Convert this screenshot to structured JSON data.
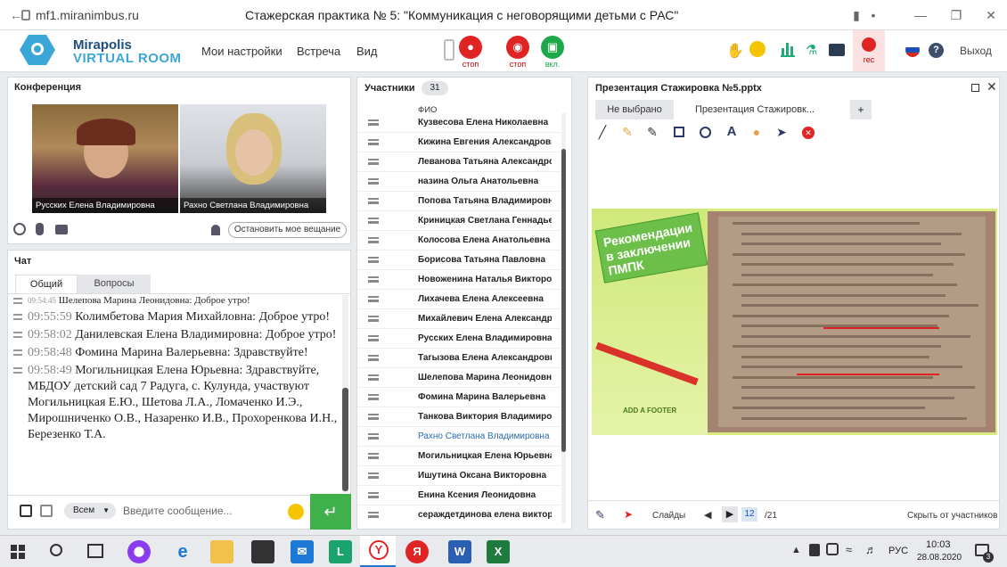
{
  "browser": {
    "url": "mf1.miranimbus.ru",
    "window_title": "Стажерская практика № 5: \"Коммуникация с неговорящими детьми с РАС\""
  },
  "app": {
    "logo_line1": "Mirapolis",
    "logo_line2": "VIRTUAL ROOM",
    "menu": [
      "Мои настройки",
      "Встреча",
      "Вид"
    ],
    "media_buttons": [
      {
        "label": "стоп",
        "color": "#e02424"
      },
      {
        "label": "стоп",
        "color": "#e02424"
      },
      {
        "label": "вкл.",
        "color": "#1ea84a"
      }
    ],
    "rec_label": "rec",
    "exit_label": "Выход"
  },
  "conference": {
    "title": "Конференция",
    "videos": [
      "Русских Елена Владимировна",
      "Рахно Светлана Владимировна"
    ],
    "stop_button": "Остановить мое вещание"
  },
  "chat": {
    "title": "Чат",
    "tabs": [
      "Общий",
      "Вопросы"
    ],
    "messages": [
      {
        "time": "09:54:45",
        "author": "Шелепова Марина Леонидовна:",
        "text": "Доброе утро!"
      },
      {
        "time": "09:55:59",
        "author": "Колимбетова Мария  Михайловна:",
        "text": "Доброе утро!"
      },
      {
        "time": "09:58:02",
        "author": "Данилевская Елена  Владимировна:",
        "text": "Доброе утро!"
      },
      {
        "time": "09:58:48",
        "author": "Фомина Марина  Валерьевна:",
        "text": "Здравствуйте!"
      },
      {
        "time": "09:58:49",
        "author": "Могильницкая  Елена Юрьевна:",
        "text": "Здравствуйте, МБДОУ детский сад 7 Радуга, с. Кулунда, участвуют Могильницкая Е.Ю., Шетова Л.А., Ломаченко И.Э., Мирошниченко О.В., Назаренко И.В., Прохоренкова И.Н., Березенко Т.А."
      }
    ],
    "recipient": "Всем",
    "input_placeholder": "Введите сообщение..."
  },
  "participants": {
    "title": "Участники",
    "count": "31",
    "column": "ФИО",
    "names": [
      "Кузвесова Елена  Николаевна",
      "Кижина Евгения  Александровна",
      "Леванова Татьяна  Александро...",
      "назина  Ольга Анатольевна",
      "Попова Татьяна  Владимировна",
      "Криницкая Светлана  Геннадье...",
      "Колосова Елена  Анатольевна",
      "Борисова  Татьяна   Павловна",
      "Новоженина Наталья  Викторов...",
      "Лихачева Елена Алексеевна",
      "Михайлевич Елена Александро...",
      "Русских Елена Владимировна",
      "Тагызова Елена  Александровна",
      "Шелепова  Марина Леонидовна",
      "Фомина Марина  Валерьевна",
      "Танкова Виктория  Владимиров...",
      "Рахно Светлана Владимировна",
      "Могильницкая  Елена Юрьевна",
      "Ишутина Оксана Викторовна",
      "Енина Ксения  Леонидовна",
      "сераждетдинова елена  викторо..."
    ],
    "highlighted_index": 16
  },
  "presentation": {
    "title": "Презентация Стажировка №5.pptx",
    "tabs": [
      "Не выбрано",
      "Презентация Стажировк...",
      "+"
    ],
    "slide_heading": "Рекомендации в заключении ПМПК",
    "slide_footer": "ADD A FOOTER",
    "slides_label": "Слайды",
    "current_slide": "12",
    "total_slides": "/21",
    "hide_label": "Скрыть от участников"
  },
  "taskbar": {
    "lang": "РУС",
    "time": "10:03",
    "date": "28.08.2020",
    "notif_count": "3"
  }
}
